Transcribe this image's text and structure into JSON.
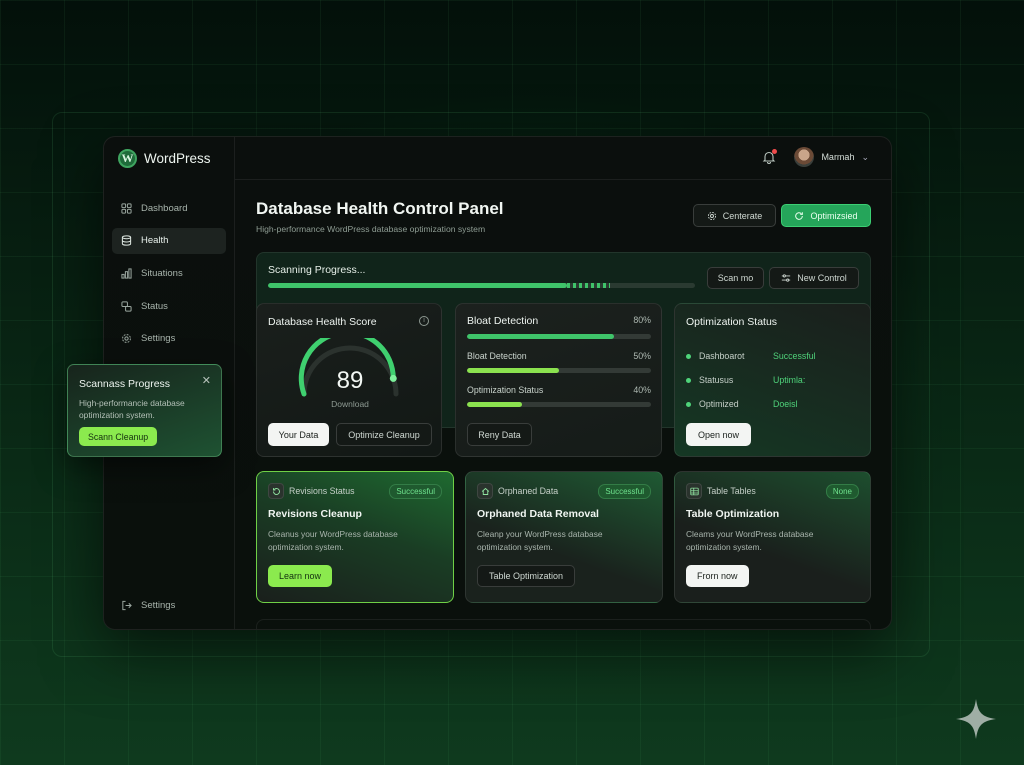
{
  "app": {
    "name": "WordPress"
  },
  "sidebar": {
    "items": [
      {
        "label": "Dashboard",
        "icon": "grid-icon"
      },
      {
        "label": "Health",
        "icon": "database-icon"
      },
      {
        "label": "Situations",
        "icon": "bar-chart-icon"
      },
      {
        "label": "Status",
        "icon": "status-icon"
      },
      {
        "label": "Settings",
        "icon": "gear-icon"
      }
    ],
    "active_index": 1,
    "bottom_item": "Settings"
  },
  "topbar": {
    "user_name": "Marmah",
    "has_notification": true
  },
  "header": {
    "title": "Database Health Control Panel",
    "subtitle": "High-performance WordPress database optimization system",
    "button_secondary": "Centerate",
    "button_primary": "Optimizsied"
  },
  "scanning": {
    "title": "Scanning Progress...",
    "progress": 0.8,
    "button_1": "Scan mo",
    "button_2": "New Control"
  },
  "health_card": {
    "title": "Database Health Score",
    "score": "89",
    "score_value": 89,
    "score_sub": "Download",
    "button_1": "Your Data",
    "button_2": "Optimize Cleanup"
  },
  "bloat_card": {
    "rows": [
      {
        "label": "Bloat Detection",
        "value": "80%",
        "fraction": 0.8,
        "color": "#3fc46a"
      },
      {
        "label": "Bloat Detection",
        "value": "50%",
        "fraction": 0.5,
        "color": "#8be24f"
      },
      {
        "label": "Optimization Status",
        "value": "40%",
        "fraction": 0.3,
        "color": "#8be24f"
      }
    ],
    "button": "Reny Data"
  },
  "optimization_card": {
    "title": "Optimization Status",
    "rows": [
      {
        "label": "Dashboarot",
        "value": "Successful"
      },
      {
        "label": "Statusus",
        "value": "Uptimla:"
      },
      {
        "label": "Optimized",
        "value": "Doeisl"
      }
    ],
    "button": "Open now"
  },
  "bottom_cards": [
    {
      "tag": "Revisions Status",
      "tag_icon": "refresh-icon",
      "badge": "Successful",
      "title": "Revisions Cleanup",
      "desc": "Cleanus your WordPress database optimization system.",
      "button": "Learn now"
    },
    {
      "tag": "Orphaned Data",
      "tag_icon": "home-icon",
      "badge": "Successful",
      "title": "Orphaned Data Removal",
      "desc": "Cleanp your WordPress database optimization system.",
      "button": "Table Optimization"
    },
    {
      "tag": "Table Tables",
      "tag_icon": "table-icon",
      "badge": "None",
      "title": "Table Optimization",
      "desc": "Cleams your WordPress database optimization system.",
      "button": "Frorn now"
    }
  ],
  "popover": {
    "title": "Scannass Progress",
    "desc": "High-performancie database optimization system.",
    "button": "Scann Cleanup"
  },
  "colors": {
    "accent": "#25a55a",
    "lime": "#8bea4e",
    "background": "#0b0f0d"
  }
}
